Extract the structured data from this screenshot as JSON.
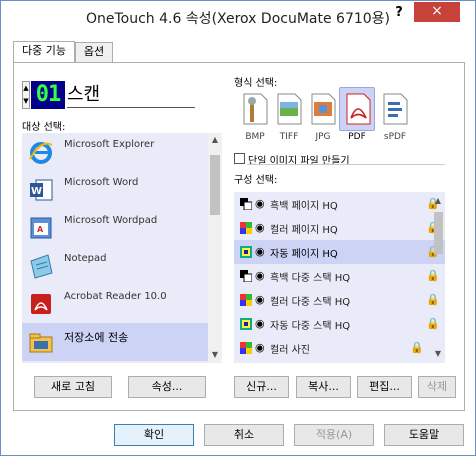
{
  "window": {
    "title": "OneTouch 4.6 속성(Xerox DocuMate 6710용)",
    "help": "?",
    "close": "×"
  },
  "tabs": [
    {
      "label": "다중 기능"
    },
    {
      "label": "옵션"
    }
  ],
  "button_number": {
    "lcd": "01",
    "label": "스캔"
  },
  "destination": {
    "heading": "대상 선택:",
    "items": [
      {
        "label": "Microsoft Explorer",
        "icon": "ie-icon"
      },
      {
        "label": "Microsoft Word",
        "icon": "word-icon"
      },
      {
        "label": "Microsoft Wordpad",
        "icon": "wordpad-icon"
      },
      {
        "label": "Notepad",
        "icon": "notepad-icon"
      },
      {
        "label": "Acrobat Reader 10.0",
        "icon": "acrobat-icon"
      },
      {
        "label": "저장소에 전송",
        "icon": "storage-icon",
        "selected": true
      }
    ]
  },
  "format": {
    "heading": "형식 선택:",
    "items": [
      {
        "label": "BMP"
      },
      {
        "label": "TIFF"
      },
      {
        "label": "JPG"
      },
      {
        "label": "PDF",
        "selected": true
      },
      {
        "label": "sPDF"
      }
    ],
    "single_file_checkbox": "단일 이미지 파일 만들기",
    "single_file_checked": false
  },
  "configuration": {
    "heading": "구성 선택:",
    "items": [
      {
        "label": "흑백 페이지 HQ",
        "color": "bw"
      },
      {
        "label": "컬러 페이지 HQ",
        "color": "color"
      },
      {
        "label": "자동 페이지 HQ",
        "color": "auto",
        "selected": true
      },
      {
        "label": "흑백 다중 스택 HQ",
        "color": "bw"
      },
      {
        "label": "컬러 다중 스택 HQ",
        "color": "color"
      },
      {
        "label": "자동 다중 스택 HQ",
        "color": "auto"
      },
      {
        "label": "컬러 사진",
        "color": "color"
      }
    ]
  },
  "left_buttons": {
    "refresh": "새로 고침",
    "properties": "속성..."
  },
  "right_buttons": {
    "new": "신규...",
    "copy": "복사...",
    "edit": "편집...",
    "delete": "삭제"
  },
  "footer": {
    "ok": "확인",
    "cancel": "취소",
    "apply": "적용(A)",
    "help": "도움말"
  },
  "colors": {
    "list_bg": "#e9ecf8",
    "selected_bg": "#ccd3f5",
    "lcd_bg": "#00008a",
    "lcd_fg": "#33ff44",
    "close_bg": "#c7423a"
  }
}
